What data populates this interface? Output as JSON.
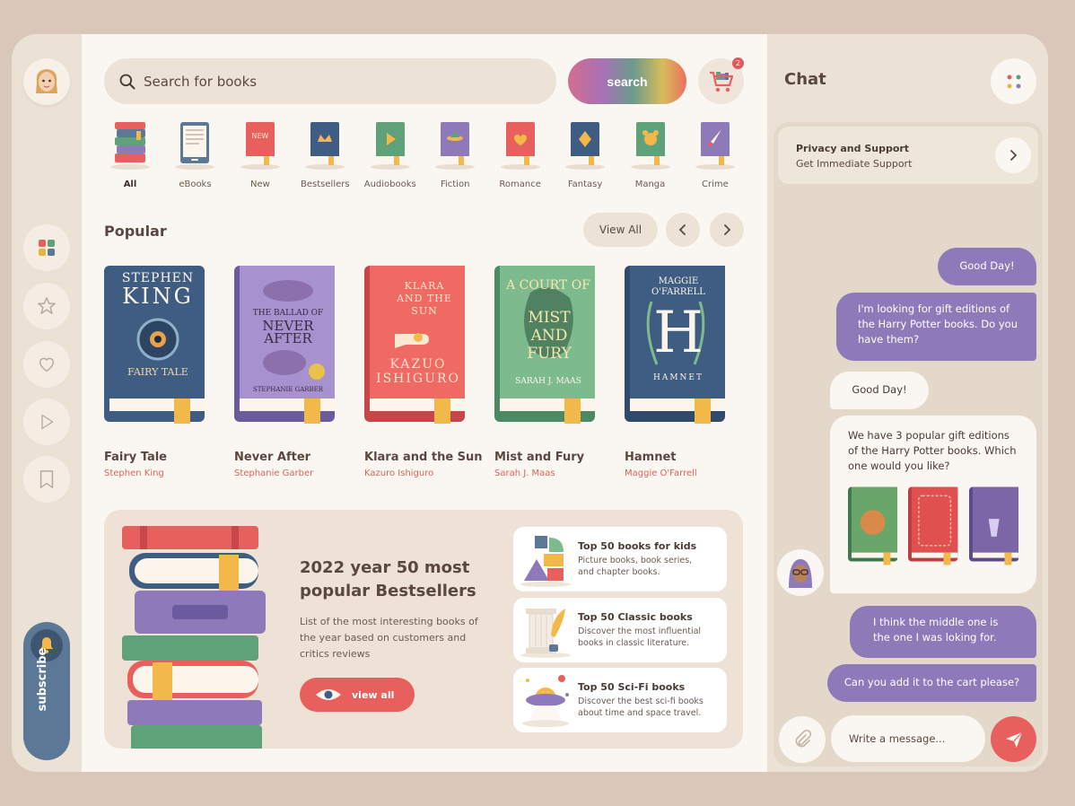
{
  "search": {
    "placeholder": "Search for books",
    "button_label": "search",
    "cart_count": "2"
  },
  "categories": [
    {
      "label": "All",
      "active": true
    },
    {
      "label": "eBooks"
    },
    {
      "label": "New",
      "badge": "NEW"
    },
    {
      "label": "Bestsellers"
    },
    {
      "label": "Audiobooks"
    },
    {
      "label": "Fiction"
    },
    {
      "label": "Romance"
    },
    {
      "label": "Fantasy"
    },
    {
      "label": "Manga"
    },
    {
      "label": "Crime"
    }
  ],
  "popular": {
    "title": "Popular",
    "view_all": "View All",
    "books": [
      {
        "title": "Fairy Tale",
        "author": "Stephen King",
        "cover_top": "STEPHEN",
        "cover_main": "KING",
        "cover_sub": "FAIRY TALE",
        "color": "#3f5d82"
      },
      {
        "title": "Never After",
        "author": "Stephanie Garber",
        "cover_top": "THE BALLAD OF",
        "cover_main": "NEVER AFTER",
        "cover_sub": "STEPHANIE GARBER",
        "color": "#8a78b6"
      },
      {
        "title": "Klara and the Sun",
        "author": "Kazuro Ishiguro",
        "cover_top": "KLARA AND THE SUN",
        "cover_main": "KAZUO",
        "cover_sub": "ISHIGURO",
        "color": "#e8605d"
      },
      {
        "title": "Mist and Fury",
        "author": "Sarah J. Maas",
        "cover_top": "A COURT OF",
        "cover_main": "MIST AND FURY",
        "cover_sub": "SARAH J. MAAS",
        "color": "#5fa27a"
      },
      {
        "title": "Hamnet",
        "author": "Maggie O'Farrell",
        "cover_top": "MAGGIE O'FARRELL",
        "cover_main": "H",
        "cover_sub": "HAMNET",
        "color": "#3f5d82"
      }
    ]
  },
  "banner": {
    "heading": "2022 year 50 most popular Bestsellers",
    "description": "List of the most interesting books of the year based on customers and critics reviews",
    "button": "view all"
  },
  "top_lists": [
    {
      "title": "Top 50 books for kids",
      "desc": "Picture books, book series, and chapter books."
    },
    {
      "title": "Top 50 Classic books",
      "desc": "Discover the most influential books in classic literature."
    },
    {
      "title": "Top 50 Sci-Fi books",
      "desc": "Discover the best sci-fi books about time and space travel."
    }
  ],
  "sidebar": {
    "subscribe": "subscribe"
  },
  "chat": {
    "title": "Chat",
    "privacy_title": "Privacy and Support",
    "privacy_sub": "Get Immediate Support",
    "messages": [
      {
        "from": "me",
        "text": "Good Day!"
      },
      {
        "from": "me",
        "text": "I'm looking for gift editions of the Harry Potter books. Do you have them?"
      },
      {
        "from": "them",
        "text": "Good Day!"
      },
      {
        "from": "them",
        "text": "We have 3 popular gift editions of the Harry Potter books. Which one would you like?"
      },
      {
        "from": "me",
        "text": "I think the middle one is the one I was loking for."
      },
      {
        "from": "me",
        "text": "Can you add it to the cart please?"
      }
    ],
    "gift_books": [
      {
        "color": "#4e8f5f"
      },
      {
        "color": "#e0504f"
      },
      {
        "color": "#7d66a8"
      }
    ],
    "composer_placeholder": "Write a message..."
  },
  "colors": {
    "accent": "#e8605d",
    "purple": "#8e7ab8",
    "navy": "#5c7897",
    "cream": "#faf6f1"
  }
}
